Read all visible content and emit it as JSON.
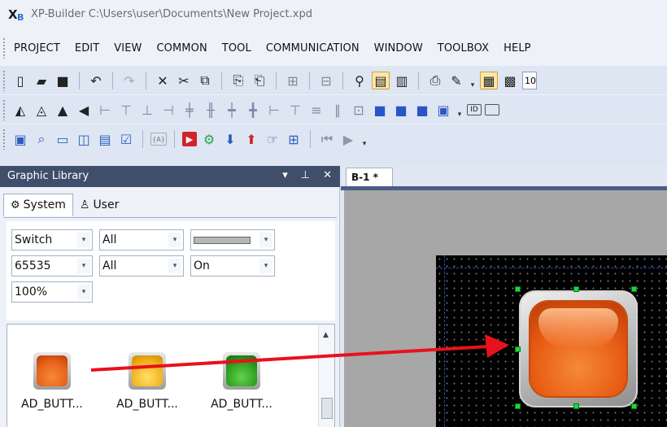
{
  "window": {
    "title": "XP-Builder C:\\Users\\user\\Documents\\New Project.xpd"
  },
  "menu": [
    "PROJECT",
    "EDIT",
    "VIEW",
    "COMMON",
    "TOOL",
    "COMMUNICATION",
    "WINDOW",
    "TOOLBOX",
    "HELP"
  ],
  "toolbar1": {
    "zoom_value": "10"
  },
  "toolbar2": {
    "object_id_icon_text": "ID"
  },
  "toolbar3": {
    "tag_icon_text": "{A}"
  },
  "library_panel": {
    "title": "Graphic Library",
    "tabs": [
      {
        "label": "System",
        "active": true,
        "icon": "system-icon"
      },
      {
        "label": "User",
        "active": false,
        "icon": "user-icon"
      }
    ],
    "filters": {
      "category": "Switch",
      "subcategory_1": "All",
      "color_swatch": "#b7b7b7",
      "size": "65535",
      "subcategory_2": "All",
      "state": "On",
      "zoom": "100%"
    },
    "items": [
      {
        "label": "AD_BUTT...",
        "color": "#e8601a"
      },
      {
        "label": "AD_BUTT...",
        "color": "#f2b21b"
      },
      {
        "label": "AD_BUTT...",
        "color": "#2c9d1e"
      }
    ]
  },
  "editor": {
    "document_tab": "B-1 *",
    "placed_object_color": "#e85c14",
    "arrow_color": "#e8111b"
  }
}
